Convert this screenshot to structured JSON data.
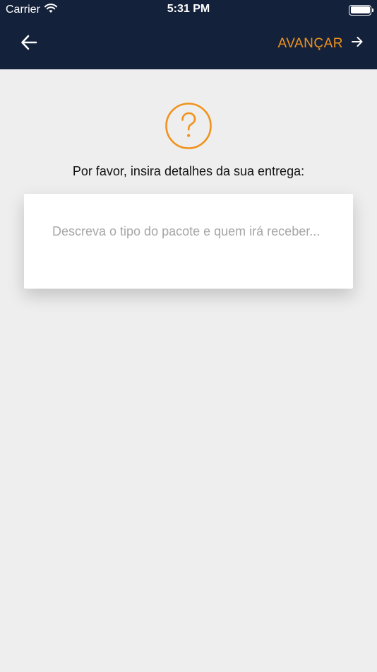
{
  "status_bar": {
    "carrier": "Carrier",
    "time": "5:31 PM",
    "battery_level": 1.0,
    "icons": [
      "wifi-icon",
      "battery-icon"
    ]
  },
  "nav": {
    "back_icon": "arrow-left-icon",
    "next_label": "AVANÇAR",
    "next_icon": "arrow-right-icon"
  },
  "main": {
    "icon": "question-circle-icon",
    "prompt": "Por favor, insira detalhes da sua entrega:",
    "details_input": {
      "value": "",
      "placeholder": "Descreva o tipo do pacote e quem irá receber..."
    }
  },
  "colors": {
    "header_bg": "#14213a",
    "accent": "#f0931e",
    "page_bg": "#eeeeee",
    "card_bg": "#ffffff"
  }
}
